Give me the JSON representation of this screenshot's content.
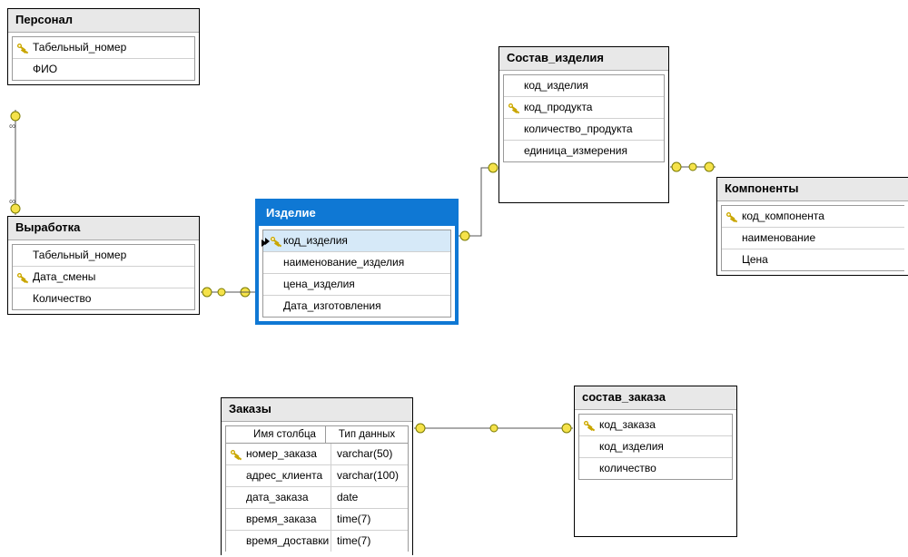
{
  "entities": {
    "personal": {
      "title": "Персонал",
      "fields": [
        {
          "name": "Табельный_номер",
          "pk": true
        },
        {
          "name": "ФИО",
          "pk": false
        }
      ]
    },
    "vyrabotka": {
      "title": "Выработка",
      "fields": [
        {
          "name": "Табельный_номер",
          "pk": false
        },
        {
          "name": "Дата_смены",
          "pk": true
        },
        {
          "name": "Количество",
          "pk": false
        }
      ]
    },
    "izdelie": {
      "title": "Изделие",
      "fields": [
        {
          "name": "код_изделия",
          "pk": true,
          "selected": true
        },
        {
          "name": "наименование_изделия",
          "pk": false
        },
        {
          "name": "цена_изделия",
          "pk": false
        },
        {
          "name": "Дата_изготовления",
          "pk": false
        }
      ]
    },
    "sostav_izdelija": {
      "title": "Состав_изделия",
      "fields": [
        {
          "name": "код_изделия",
          "pk": false
        },
        {
          "name": "код_продукта",
          "pk": true
        },
        {
          "name": "количество_продукта",
          "pk": false
        },
        {
          "name": "единица_измерения",
          "pk": false
        }
      ]
    },
    "komponenty": {
      "title": "Компоненты",
      "fields": [
        {
          "name": "код_компонента",
          "pk": true
        },
        {
          "name": "наименование",
          "pk": false
        },
        {
          "name": "Цена",
          "pk": false
        }
      ]
    },
    "zakazy": {
      "title": "Заказы",
      "subheader": {
        "col1": "Имя столбца",
        "col2": "Тип данных"
      },
      "fields": [
        {
          "name": "номер_заказа",
          "type": "varchar(50)",
          "pk": true
        },
        {
          "name": "адрес_клиента",
          "type": "varchar(100)",
          "pk": false
        },
        {
          "name": "дата_заказа",
          "type": "date",
          "pk": false
        },
        {
          "name": "время_заказа",
          "type": "time(7)",
          "pk": false
        },
        {
          "name": "время_доставки",
          "type": "time(7)",
          "pk": false
        }
      ]
    },
    "sostav_zakaza": {
      "title": "состав_заказа",
      "fields": [
        {
          "name": "код_заказа",
          "pk": true
        },
        {
          "name": "код_изделия",
          "pk": false
        },
        {
          "name": "количество",
          "pk": false
        }
      ]
    }
  }
}
